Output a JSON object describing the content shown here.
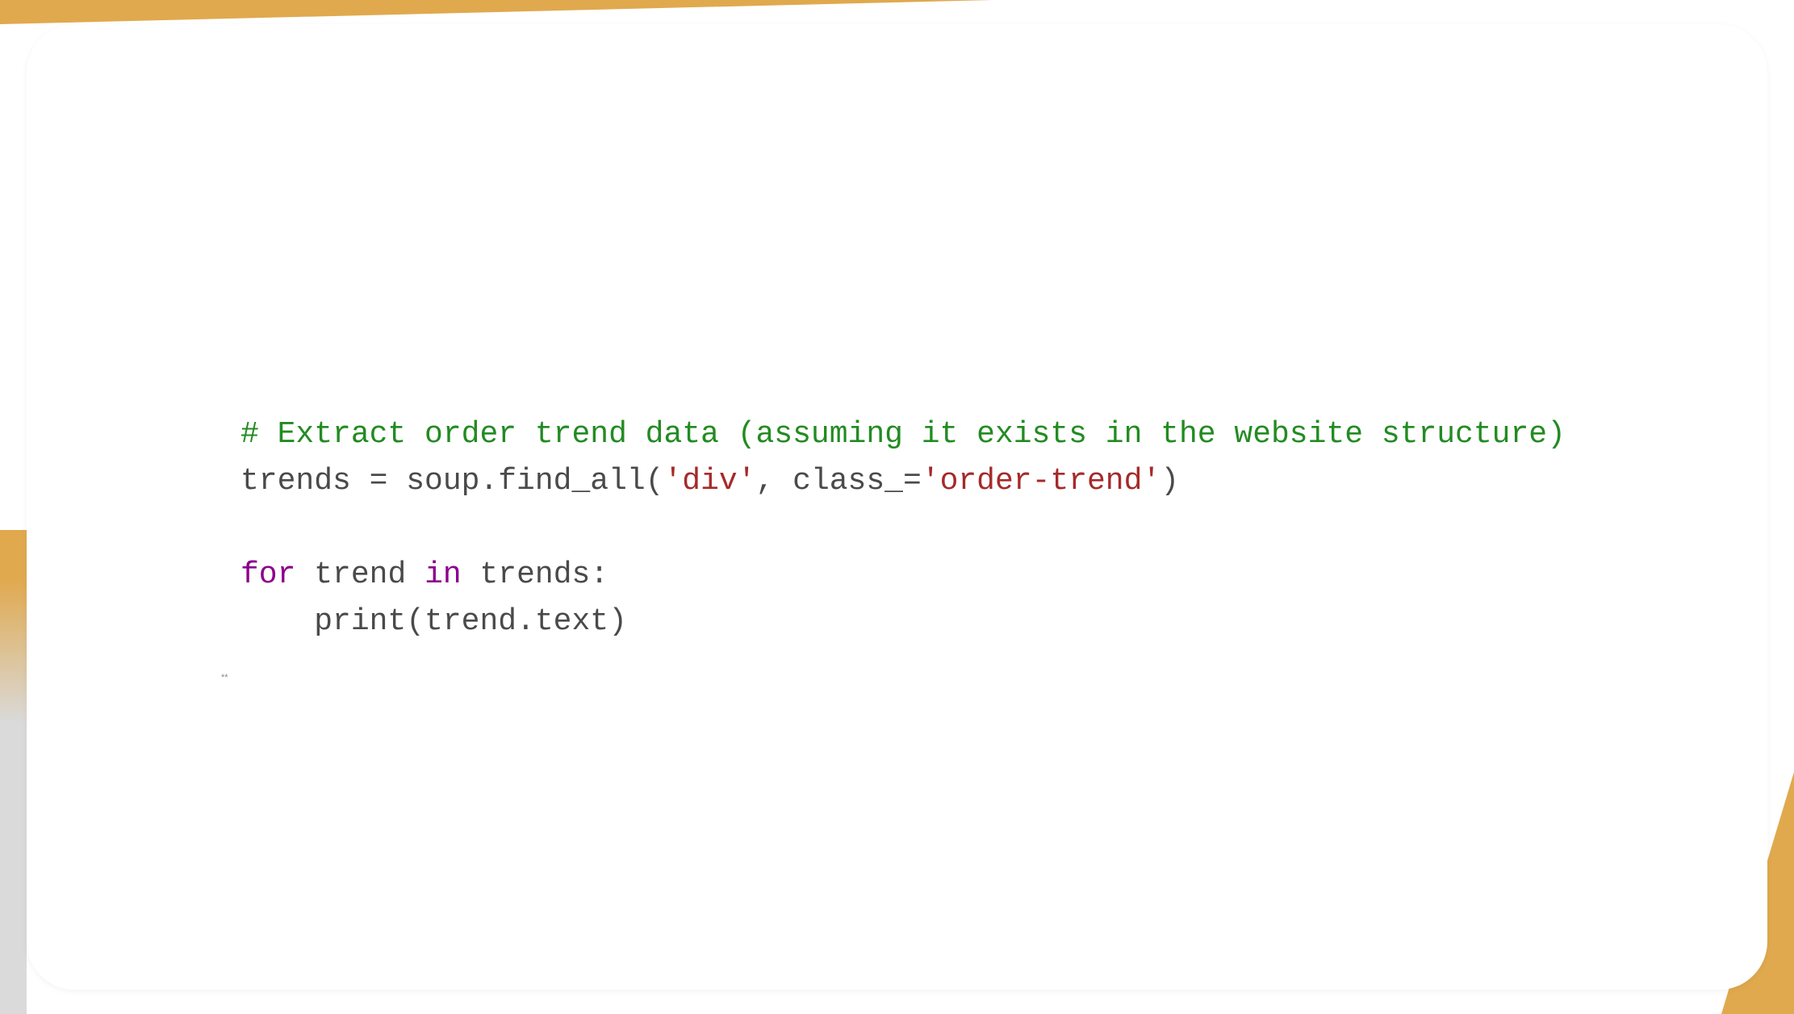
{
  "code": {
    "comment": "# Extract order trend data (assuming it exists in the website structure)",
    "line2_prefix": "trends = soup.find_all(",
    "line2_str1": "'div'",
    "line2_mid": ", class_=",
    "line2_str2": "'order-trend'",
    "line2_suffix": ")",
    "line4_for": "for",
    "line4_var": " trend ",
    "line4_in": "in",
    "line4_rest": " trends:",
    "line5": "    print(trend.text)"
  },
  "footnote": "**"
}
